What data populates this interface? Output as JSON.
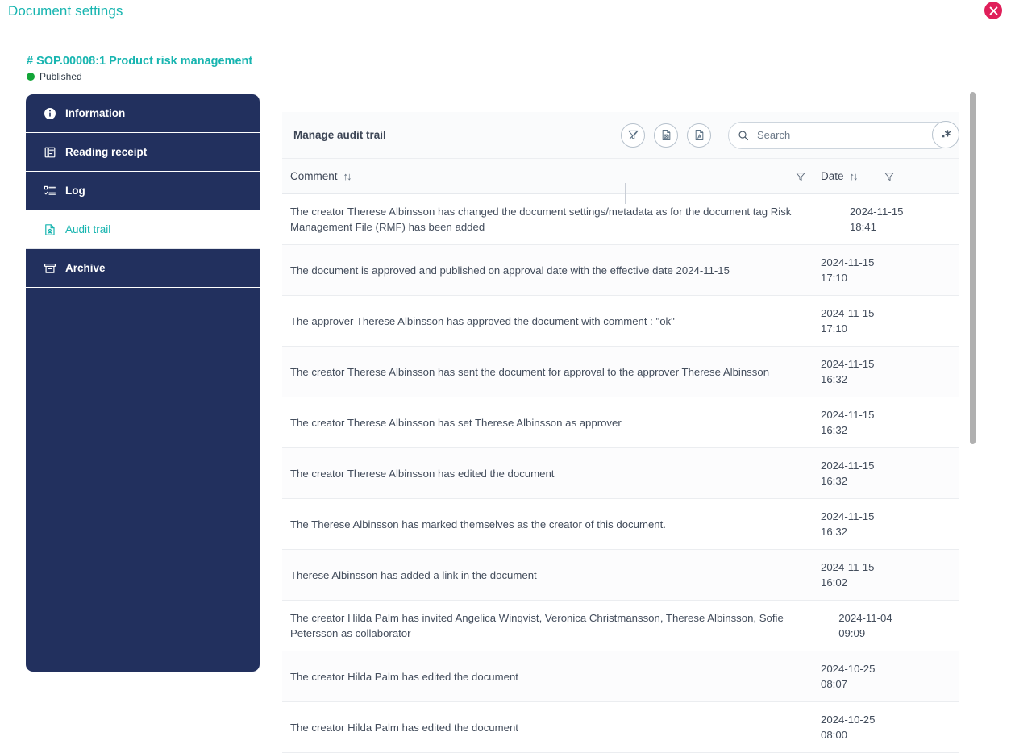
{
  "header": {
    "title": "Document settings",
    "close_label": "×"
  },
  "document": {
    "code": "# SOP.00008:1 Product risk management",
    "status": "Published",
    "status_color": "#13a538",
    "accent_color": "#18b5b0"
  },
  "sidebar": {
    "items": [
      {
        "label": "Information",
        "icon": "info-icon",
        "active": false
      },
      {
        "label": "Reading receipt",
        "icon": "book-icon",
        "active": false
      },
      {
        "label": "Log",
        "icon": "checklist-icon",
        "active": false
      },
      {
        "label": "Audit trail",
        "icon": "audit-file-icon",
        "active": true
      },
      {
        "label": "Archive",
        "icon": "archive-box-icon",
        "active": false
      }
    ]
  },
  "panel": {
    "title": "Manage audit trail",
    "toolbar": [
      {
        "name": "clear-filter-button",
        "icon": "filter-off-icon"
      },
      {
        "name": "export-excel-button",
        "icon": "file-excel-icon"
      },
      {
        "name": "export-pdf-button",
        "icon": "file-pdf-icon"
      }
    ],
    "search": {
      "placeholder": "Search",
      "value": "",
      "wildcard_label": "wildcard-icon"
    }
  },
  "table": {
    "columns": [
      {
        "key": "comment",
        "label": "Comment",
        "sortable": true,
        "filterable": true
      },
      {
        "key": "date",
        "label": "Date",
        "sortable": true,
        "filterable": true
      }
    ],
    "sort_glyph": "↑↓",
    "rows": [
      {
        "comment": "The creator Therese Albinsson has changed the document settings/metadata as for the document tag Risk Management File (RMF) has been added",
        "date": "2024-11-15\n18:41"
      },
      {
        "comment": "The document is approved and published on approval date with the effective date 2024-11-15",
        "date": "2024-11-15\n17:10"
      },
      {
        "comment": "The approver Therese Albinsson has approved the document with comment : \"ok\"",
        "date": "2024-11-15\n17:10"
      },
      {
        "comment": "The creator Therese Albinsson has sent the document for approval to the approver Therese Albinsson",
        "date": "2024-11-15\n16:32"
      },
      {
        "comment": "The creator Therese Albinsson has set Therese Albinsson as approver",
        "date": "2024-11-15\n16:32"
      },
      {
        "comment": "The creator Therese Albinsson has edited the document",
        "date": "2024-11-15\n16:32"
      },
      {
        "comment": "The Therese Albinsson has marked themselves as the creator of this document.",
        "date": "2024-11-15\n16:32"
      },
      {
        "comment": "Therese Albinsson has added a link in the document",
        "date": "2024-11-15\n16:02"
      },
      {
        "comment": "The creator Hilda Palm has invited Angelica Winqvist, Veronica Christmansson, Therese Albinsson, Sofie Petersson as collaborator",
        "date": "2024-11-04\n09:09"
      },
      {
        "comment": "The creator Hilda Palm has edited the document",
        "date": "2024-10-25\n08:07"
      },
      {
        "comment": "The creator Hilda Palm has edited the document",
        "date": "2024-10-25\n08:00"
      }
    ]
  }
}
